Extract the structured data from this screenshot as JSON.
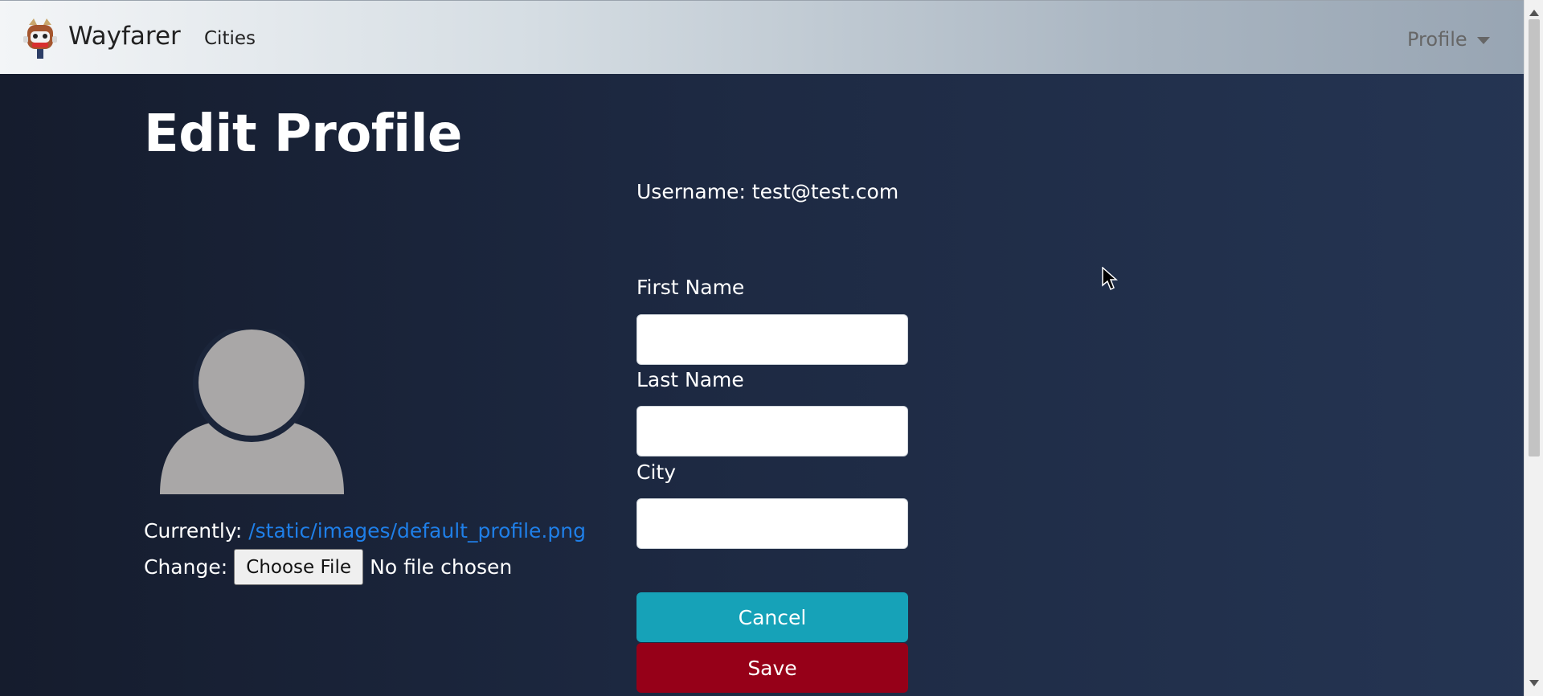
{
  "navbar": {
    "brand": "Wayfarer",
    "links": [
      "Cities"
    ],
    "profile_label": "Profile"
  },
  "page": {
    "title": "Edit Profile",
    "username": "Username: test@test.com"
  },
  "avatar": {
    "currently_label": "Currently:",
    "current_path": "/static/images/default_profile.png",
    "change_label": "Change:",
    "choose_file_label": "Choose File",
    "no_file_text": "No file chosen"
  },
  "form": {
    "first_name_label": "First Name",
    "first_name_value": "",
    "last_name_label": "Last Name",
    "last_name_value": "",
    "city_label": "City",
    "city_value": "",
    "cancel_label": "Cancel",
    "save_label": "Save"
  },
  "colors": {
    "cancel_button": "#16a2b8",
    "save_button": "#960018",
    "link": "#1f7fe8",
    "background": "#1d2942"
  }
}
